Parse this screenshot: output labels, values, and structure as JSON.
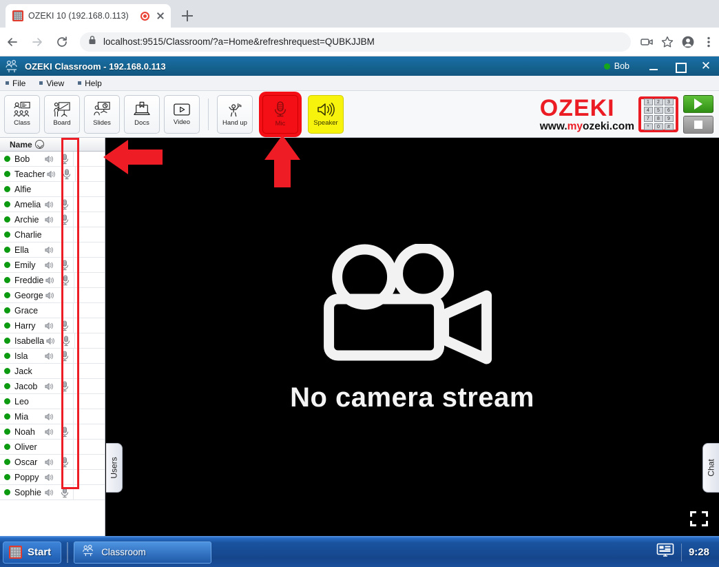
{
  "browser": {
    "tab": {
      "title": "OZEKI 10 (192.168.0.113)",
      "favicon": "ozeki-grid-icon",
      "recording_indicator": "record-dot-icon",
      "close": "close-icon"
    },
    "new_tab_label": "+",
    "nav": {
      "back": "back-arrow-icon",
      "forward": "forward-arrow-icon",
      "reload": "reload-icon"
    },
    "omnibox": {
      "lock": "lock-icon",
      "url": "localhost:9515/Classroom/?a=Home&refreshrequest=QUBKJJBM"
    },
    "toolbar_icons": {
      "camera": "video-camera-icon",
      "star": "bookmark-star-icon",
      "profile": "profile-avatar-icon",
      "menu": "three-dot-menu-icon"
    },
    "window_controls": {
      "minimize": "minimize-icon",
      "maximize": "maximize-icon",
      "close": "close-icon"
    }
  },
  "app": {
    "title": "OZEKI Classroom",
    "title_separator": "-",
    "host": "192.168.0.113",
    "user": {
      "name": "Bob",
      "status_color": "#16a61b"
    },
    "window_controls": {
      "minimize": "minimize-icon",
      "maximize": "maximize-icon",
      "close": "close-icon"
    },
    "menu": [
      {
        "label": "File"
      },
      {
        "label": "View"
      },
      {
        "label": "Help"
      }
    ],
    "toolbar": [
      {
        "label": "Class",
        "icon": "class-people-icon",
        "state": "normal"
      },
      {
        "label": "Board",
        "icon": "whiteboard-icon",
        "state": "normal"
      },
      {
        "label": "Slides",
        "icon": "slides-presenter-icon",
        "state": "normal"
      },
      {
        "label": "Docs",
        "icon": "document-laptop-icon",
        "state": "normal"
      },
      {
        "label": "Video",
        "icon": "video-play-icon",
        "state": "normal"
      },
      {
        "label": "Hand up",
        "icon": "hand-up-person-icon",
        "state": "normal"
      },
      {
        "label": "Mic",
        "icon": "microphone-icon",
        "state": "active-red"
      },
      {
        "label": "Speaker",
        "icon": "speaker-icon",
        "state": "active-yellow"
      }
    ],
    "brand": {
      "name": "OZEKI",
      "url_prefix": "www.",
      "url_highlight": "my",
      "url_suffix": "ozeki.com",
      "keypad_keys": [
        "1",
        "2",
        "3",
        "4",
        "5",
        "6",
        "7",
        "8",
        "9",
        "*",
        "0",
        "#"
      ],
      "accent_color": "#ec1c24"
    },
    "media_buttons": {
      "play": "play-icon",
      "stop": "stop-icon"
    }
  },
  "userlist": {
    "header": {
      "label": "Name",
      "sort_icon": "chevron-down-circle-icon"
    },
    "column_icons": {
      "speaker": "speaker-small-icon",
      "mic": "microphone-small-icon"
    },
    "rows": [
      {
        "name": "Bob",
        "online": true,
        "speaker": true,
        "mic": true
      },
      {
        "name": "Teacher",
        "online": true,
        "speaker": true,
        "mic": true
      },
      {
        "name": "Alfie",
        "online": true,
        "speaker": false,
        "mic": false
      },
      {
        "name": "Amelia",
        "online": true,
        "speaker": true,
        "mic": true
      },
      {
        "name": "Archie",
        "online": true,
        "speaker": true,
        "mic": true
      },
      {
        "name": "Charlie",
        "online": true,
        "speaker": false,
        "mic": false
      },
      {
        "name": "Ella",
        "online": true,
        "speaker": true,
        "mic": false
      },
      {
        "name": "Emily",
        "online": true,
        "speaker": true,
        "mic": true
      },
      {
        "name": "Freddie",
        "online": true,
        "speaker": true,
        "mic": true
      },
      {
        "name": "George",
        "online": true,
        "speaker": true,
        "mic": false
      },
      {
        "name": "Grace",
        "online": true,
        "speaker": false,
        "mic": false
      },
      {
        "name": "Harry",
        "online": true,
        "speaker": true,
        "mic": true
      },
      {
        "name": "Isabella",
        "online": true,
        "speaker": true,
        "mic": true
      },
      {
        "name": "Isla",
        "online": true,
        "speaker": true,
        "mic": true
      },
      {
        "name": "Jack",
        "online": true,
        "speaker": false,
        "mic": false
      },
      {
        "name": "Jacob",
        "online": true,
        "speaker": true,
        "mic": true
      },
      {
        "name": "Leo",
        "online": true,
        "speaker": false,
        "mic": false
      },
      {
        "name": "Mia",
        "online": true,
        "speaker": true,
        "mic": false
      },
      {
        "name": "Noah",
        "online": true,
        "speaker": true,
        "mic": true
      },
      {
        "name": "Oliver",
        "online": true,
        "speaker": false,
        "mic": false
      },
      {
        "name": "Oscar",
        "online": true,
        "speaker": true,
        "mic": true
      },
      {
        "name": "Poppy",
        "online": true,
        "speaker": true,
        "mic": false
      },
      {
        "name": "Sophie",
        "online": true,
        "speaker": true,
        "mic": true
      }
    ]
  },
  "stage": {
    "placeholder_text": "No camera stream",
    "camera_icon": "video-camera-large-icon",
    "fullscreen_icon": "fullscreen-expand-icon"
  },
  "panels": {
    "users_tab": "Users",
    "chat_tab": "Chat"
  },
  "annotations": {
    "arrow_left": "red-arrow-left",
    "arrow_up": "red-arrow-up",
    "highlight_color": "#ee1c24"
  },
  "taskbar": {
    "start_label": "Start",
    "start_icon": "ozeki-grid-icon",
    "tasks": [
      {
        "label": "Classroom",
        "icon": "ozeki-classroom-icon"
      }
    ],
    "tray_icon": "display-monitor-icon",
    "clock": "9:28"
  }
}
